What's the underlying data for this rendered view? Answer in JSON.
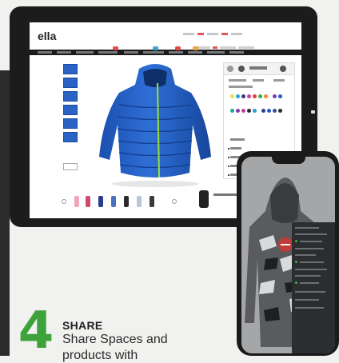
{
  "colors": {
    "accent_green": "#3da23a",
    "jacket_blue": "#1f5fc4",
    "zip_green": "#9adf3c",
    "device_frame": "#1c1c1c"
  },
  "tablet": {
    "logo": "ella"
  },
  "step": {
    "number": "4",
    "title": "SHARE",
    "description_line1": "Share Spaces and",
    "description_line2": "products with"
  },
  "icons": {
    "camera": "camera-icon",
    "zoom": "zoom-icon",
    "prev": "chevron-left-icon",
    "next": "chevron-right-icon"
  }
}
